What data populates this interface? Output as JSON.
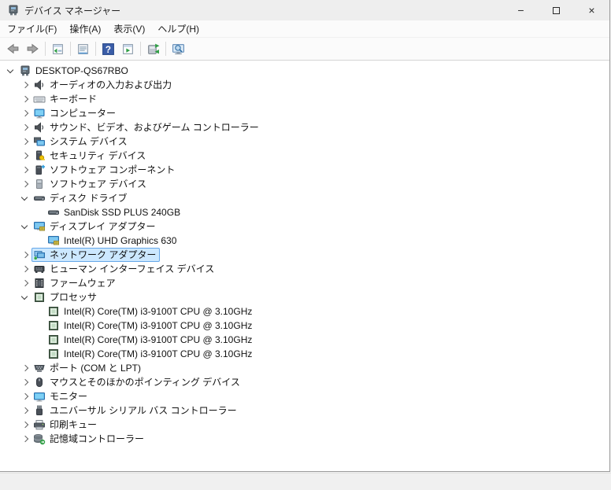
{
  "window": {
    "title": "デバイス マネージャー",
    "controls": {
      "minimize": "−",
      "maximize": "",
      "close": "×"
    }
  },
  "menubar": {
    "items": [
      {
        "label": "ファイル(F)"
      },
      {
        "label": "操作(A)"
      },
      {
        "label": "表示(V)"
      },
      {
        "label": "ヘルプ(H)"
      }
    ]
  },
  "toolbar": {
    "buttons": [
      {
        "name": "back",
        "icon": "arrow-left-icon"
      },
      {
        "name": "forward",
        "icon": "arrow-right-icon"
      },
      {
        "name": "separator"
      },
      {
        "name": "show-console-tree",
        "icon": "console-tree-icon"
      },
      {
        "name": "separator"
      },
      {
        "name": "properties",
        "icon": "properties-icon"
      },
      {
        "name": "separator"
      },
      {
        "name": "help",
        "icon": "help-icon"
      },
      {
        "name": "action-pane",
        "icon": "action-pane-icon"
      },
      {
        "name": "separator"
      },
      {
        "name": "update-driver",
        "icon": "update-driver-icon"
      },
      {
        "name": "separator"
      },
      {
        "name": "scan-hardware-changes",
        "icon": "scan-monitor-icon"
      }
    ]
  },
  "tree": {
    "rows": [
      {
        "id": "computer-desktop-qs67rbo",
        "level": 0,
        "state": "expanded",
        "icon": "computer-root",
        "label": "DESKTOP-QS67RBO",
        "selected": false
      },
      {
        "id": "audio-inputs-outputs",
        "level": 1,
        "state": "collapsed",
        "icon": "audio",
        "label": "オーディオの入力および出力",
        "selected": false
      },
      {
        "id": "keyboards",
        "level": 1,
        "state": "collapsed",
        "icon": "keyboard",
        "label": "キーボード",
        "selected": false
      },
      {
        "id": "computers",
        "level": 1,
        "state": "collapsed",
        "icon": "monitor-blue",
        "label": "コンピューター",
        "selected": false
      },
      {
        "id": "sound-video-game-controllers",
        "level": 1,
        "state": "collapsed",
        "icon": "audio",
        "label": "サウンド、ビデオ、およびゲーム コントローラー",
        "selected": false
      },
      {
        "id": "system-devices",
        "level": 1,
        "state": "collapsed",
        "icon": "system",
        "label": "システム デバイス",
        "selected": false
      },
      {
        "id": "security-devices",
        "level": 1,
        "state": "collapsed",
        "icon": "security",
        "label": "セキュリティ デバイス",
        "selected": false
      },
      {
        "id": "software-components",
        "level": 1,
        "state": "collapsed",
        "icon": "sw-component",
        "label": "ソフトウェア コンポーネント",
        "selected": false
      },
      {
        "id": "software-devices",
        "level": 1,
        "state": "collapsed",
        "icon": "sw-device",
        "label": "ソフトウェア デバイス",
        "selected": false
      },
      {
        "id": "disk-drives",
        "level": 1,
        "state": "expanded",
        "icon": "disk",
        "label": "ディスク ドライブ",
        "selected": false
      },
      {
        "id": "sandisk-ssd",
        "level": 2,
        "state": "leaf",
        "icon": "disk",
        "label": "SanDisk SSD PLUS 240GB",
        "selected": false
      },
      {
        "id": "display-adapters",
        "level": 1,
        "state": "expanded",
        "icon": "display",
        "label": "ディスプレイ アダプター",
        "selected": false
      },
      {
        "id": "intel-uhd-630",
        "level": 2,
        "state": "leaf",
        "icon": "display",
        "label": "Intel(R) UHD Graphics 630",
        "selected": false
      },
      {
        "id": "network-adapters",
        "level": 1,
        "state": "collapsed",
        "icon": "network",
        "label": "ネットワーク アダプター",
        "selected": true
      },
      {
        "id": "human-interface-devices",
        "level": 1,
        "state": "collapsed",
        "icon": "hid",
        "label": "ヒューマン インターフェイス デバイス",
        "selected": false
      },
      {
        "id": "firmware",
        "level": 1,
        "state": "collapsed",
        "icon": "firmware",
        "label": "ファームウェア",
        "selected": false
      },
      {
        "id": "processors",
        "level": 1,
        "state": "expanded",
        "icon": "cpu",
        "label": "プロセッサ",
        "selected": false
      },
      {
        "id": "cpu-0",
        "level": 2,
        "state": "leaf",
        "icon": "cpu",
        "label": "Intel(R) Core(TM) i3-9100T CPU @ 3.10GHz",
        "selected": false
      },
      {
        "id": "cpu-1",
        "level": 2,
        "state": "leaf",
        "icon": "cpu",
        "label": "Intel(R) Core(TM) i3-9100T CPU @ 3.10GHz",
        "selected": false
      },
      {
        "id": "cpu-2",
        "level": 2,
        "state": "leaf",
        "icon": "cpu",
        "label": "Intel(R) Core(TM) i3-9100T CPU @ 3.10GHz",
        "selected": false
      },
      {
        "id": "cpu-3",
        "level": 2,
        "state": "leaf",
        "icon": "cpu",
        "label": "Intel(R) Core(TM) i3-9100T CPU @ 3.10GHz",
        "selected": false
      },
      {
        "id": "ports-com-lpt",
        "level": 1,
        "state": "collapsed",
        "icon": "port",
        "label": "ポート (COM と LPT)",
        "selected": false
      },
      {
        "id": "mice-pointing-devices",
        "level": 1,
        "state": "collapsed",
        "icon": "mouse",
        "label": "マウスとそのほかのポインティング デバイス",
        "selected": false
      },
      {
        "id": "monitors",
        "level": 1,
        "state": "collapsed",
        "icon": "monitor2",
        "label": "モニター",
        "selected": false
      },
      {
        "id": "usb-controllers",
        "level": 1,
        "state": "collapsed",
        "icon": "usb",
        "label": "ユニバーサル シリアル バス コントローラー",
        "selected": false
      },
      {
        "id": "print-queues",
        "level": 1,
        "state": "collapsed",
        "icon": "printer",
        "label": "印刷キュー",
        "selected": false
      },
      {
        "id": "storage-controllers",
        "level": 1,
        "state": "collapsed",
        "icon": "storage",
        "label": "記憶域コントローラー",
        "selected": false
      }
    ]
  },
  "colors": {
    "selection_bg": "#cce8ff",
    "selection_border": "#66a7e8",
    "titlebar_bg": "#eeeeee",
    "help_blue": "#3a5da8",
    "monitor_blue": "#49b0e8",
    "cpu_green": "#4f6a52",
    "scan_green": "#2f9e44"
  }
}
